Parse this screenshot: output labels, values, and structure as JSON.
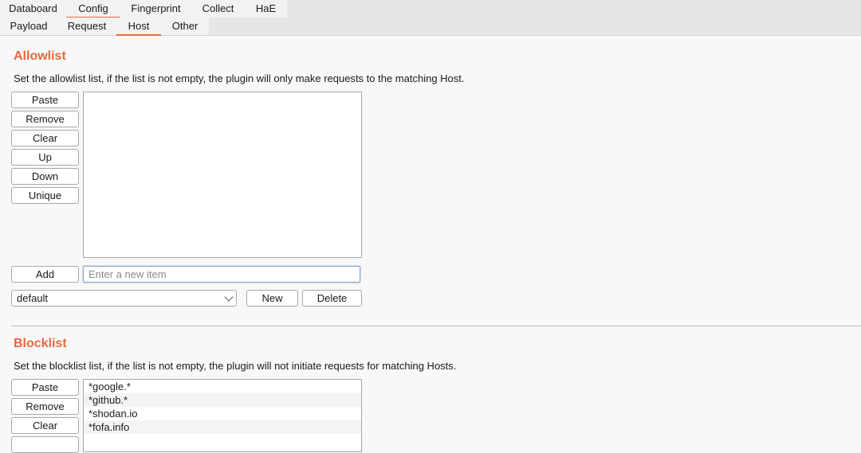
{
  "main_tabs": [
    "Databoard",
    "Config",
    "Fingerprint",
    "Collect",
    "HaE"
  ],
  "main_tab_active": "Config",
  "sub_tabs": [
    "Payload",
    "Request",
    "Host",
    "Other"
  ],
  "sub_tab_active": "Host",
  "accent_color": "#e8693f",
  "allowlist": {
    "title": "Allowlist",
    "description": "Set the allowlist list, if the list is not empty, the plugin will only make requests to the matching Host.",
    "buttons": [
      "Paste",
      "Remove",
      "Clear",
      "Up",
      "Down",
      "Unique"
    ],
    "items": [],
    "add_label": "Add",
    "input_placeholder": "Enter a new item",
    "select_value": "default",
    "new_label": "New",
    "delete_label": "Delete"
  },
  "blocklist": {
    "title": "Blocklist",
    "description": "Set the blocklist list, if the list is not empty, the plugin will not initiate requests for matching Hosts.",
    "buttons": [
      "Paste",
      "Remove",
      "Clear"
    ],
    "items": [
      "*google.*",
      "*github.*",
      "*shodan.io",
      "*fofa.info"
    ]
  }
}
